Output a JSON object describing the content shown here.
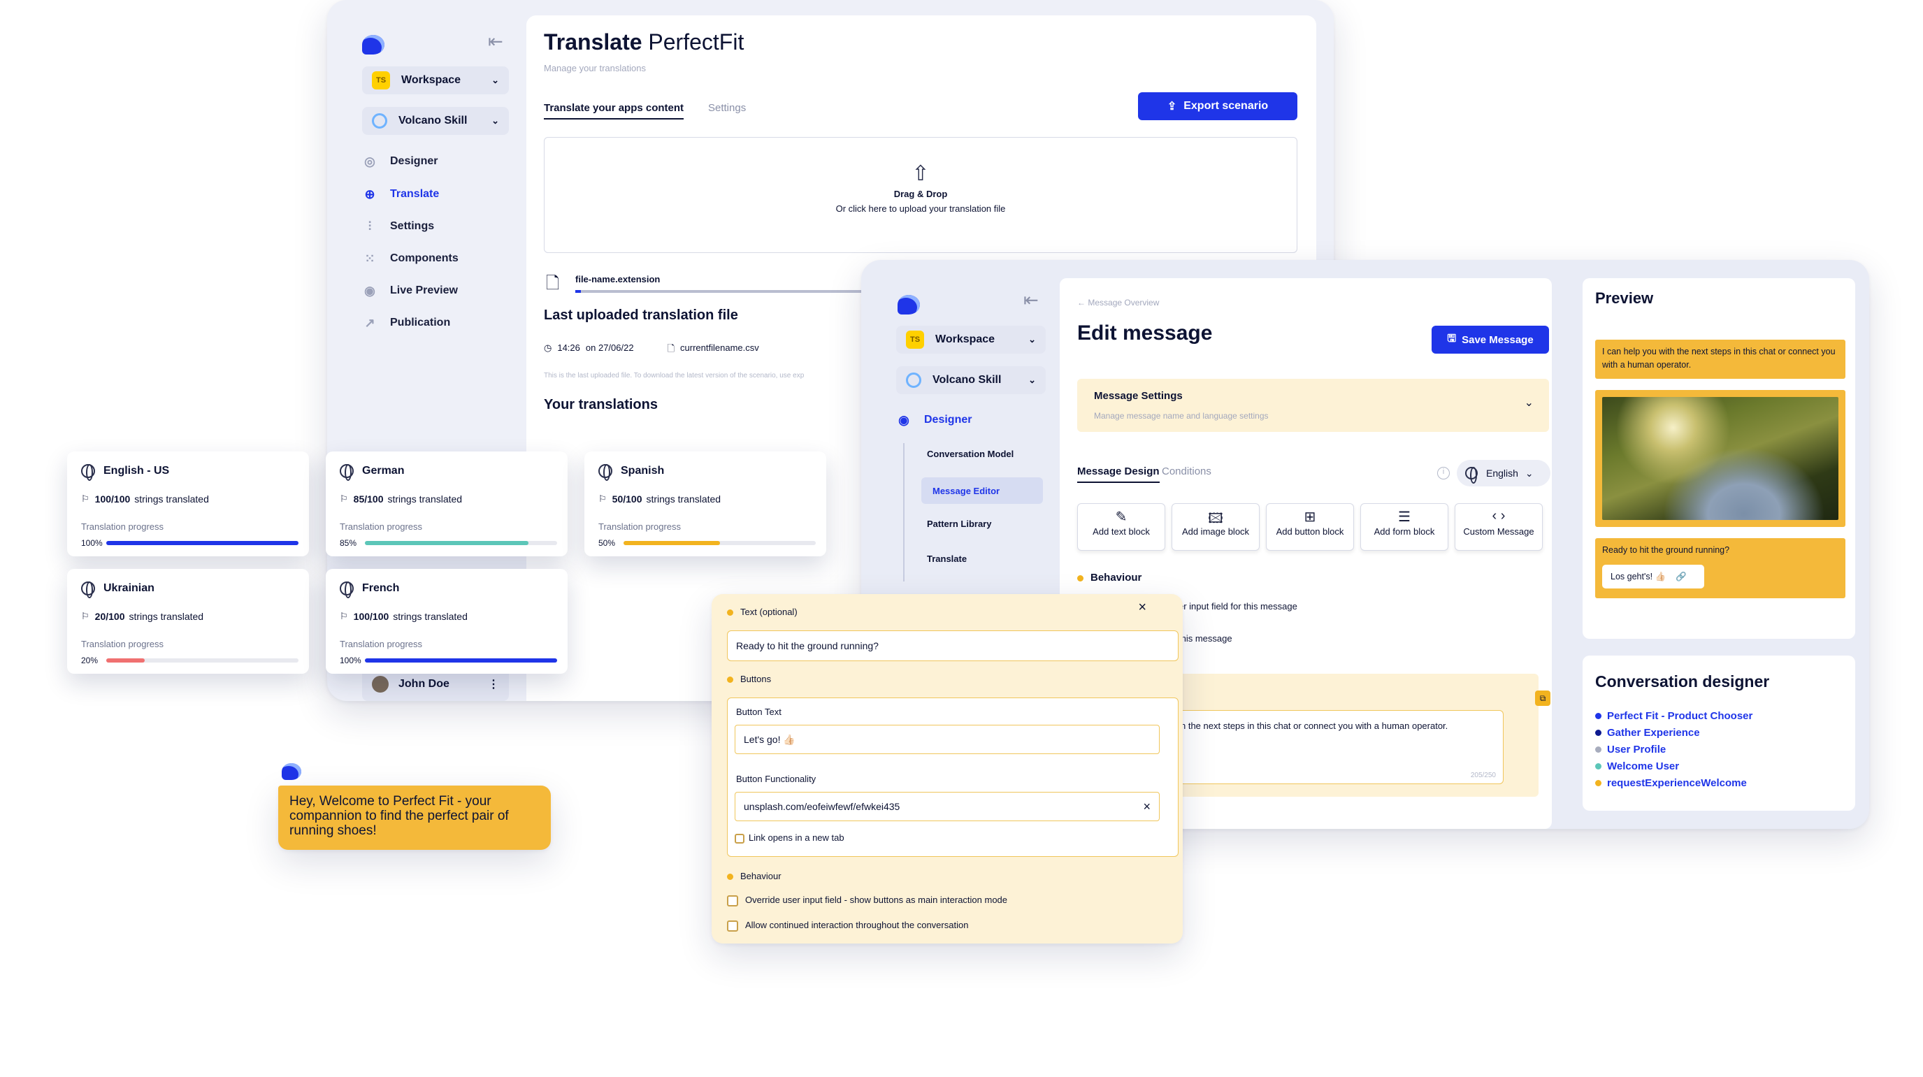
{
  "translate": {
    "logo": "chat-logo",
    "workspace": "Workspace",
    "workspace_badge": "TS",
    "project": "Volcano Skill",
    "nav": [
      "Designer",
      "Translate",
      "Settings",
      "Components",
      "Live Preview",
      "Publication"
    ],
    "title_bold": "Translate",
    "title_rest": " PerfectFit",
    "subtitle": "Manage your translations",
    "tabs": [
      "Translate your apps content",
      "Settings"
    ],
    "export": "Export scenario",
    "drop_title": "Drag & Drop",
    "drop_sub": "Or click here to upload your translation file",
    "file_name": "file-name.extension",
    "last_uploaded": "Last uploaded translation file",
    "time": "14:26",
    "date": "on 27/06/22",
    "current_file": "currentfilename.csv",
    "note": "This is the last uploaded file. To download the latest version of the scenario, use exp",
    "your_translations": "Your translations",
    "user": "John Doe"
  },
  "languages": [
    {
      "name": "English - US",
      "count": "100/100",
      "label": "strings translated",
      "progress_label": "Translation progress",
      "pct": "100%",
      "fraction": 1.0,
      "color": "#1f35e8"
    },
    {
      "name": "German",
      "count": "85/100",
      "label": "strings translated",
      "progress_label": "Translation progress",
      "pct": "85%",
      "fraction": 0.85,
      "color": "#5cc6b8"
    },
    {
      "name": "Spanish",
      "count": "50/100",
      "label": "strings translated",
      "progress_label": "Translation progress",
      "pct": "50%",
      "fraction": 0.5,
      "color": "#f2b31f"
    },
    {
      "name": "Ukrainian",
      "count": "20/100",
      "label": "strings translated",
      "progress_label": "Translation progress",
      "pct": "20%",
      "fraction": 0.2,
      "color": "#f07070"
    },
    {
      "name": "French",
      "count": "100/100",
      "label": "strings translated",
      "progress_label": "Translation progress",
      "pct": "100%",
      "fraction": 1.0,
      "color": "#1f35e8"
    }
  ],
  "editor": {
    "workspace": "Workspace",
    "workspace_badge": "TS",
    "project": "Volcano Skill",
    "nav_designer": "Designer",
    "sub_nav": [
      "Conversation Model",
      "Message Editor",
      "Pattern Library",
      "Translate"
    ],
    "breadcrumb": "Message Overview",
    "title": "Edit message",
    "save": "Save Message",
    "settings_title": "Message Settings",
    "settings_sub": "Manage message name and language settings",
    "tabs": [
      "Message Design",
      "Conditions"
    ],
    "language": "English",
    "tiles": [
      "Add text block",
      "Add image block",
      "Add button block",
      "Add form block",
      "Custom Message"
    ],
    "behaviour": "Behaviour",
    "behaviour_line1": "er input field for this message",
    "behaviour_line2": "this message",
    "msg_text": "n the next steps in this chat or connect you with a human operator.",
    "counter": "205/250"
  },
  "preview": {
    "title": "Preview",
    "bubble1": "I can help you with the next steps in this chat or connect you with a human operator.",
    "bubble2": "Ready to hit the ground running?",
    "button": "Los geht's! 👍🏻"
  },
  "conversation": {
    "title": "Conversation designer",
    "items": [
      {
        "label": "Perfect Fit - Product Chooser",
        "color": "#1f35e8"
      },
      {
        "label": "Gather Experience",
        "color": "#0d1a8f"
      },
      {
        "label": "User Profile",
        "color": "#a7acbd"
      },
      {
        "label": "Welcome User",
        "color": "#5cc6b8"
      },
      {
        "label": "requestExperienceWelcome",
        "color": "#f2b31f"
      }
    ]
  },
  "form": {
    "text_label": "Text (optional)",
    "text_value": "Ready to hit the ground running?",
    "buttons_label": "Buttons",
    "button_text_label": "Button Text",
    "button_text_value": "Let's go! 👍🏻",
    "button_func_label": "Button Functionality",
    "button_func_value": "unsplash.com/eofeiwfewf/efwkei435",
    "new_tab": "Link opens in a new tab",
    "behaviour_label": "Behaviour",
    "opt1": "Override user input field - show buttons as main interaction mode",
    "opt2": "Allow continued interaction throughout the conversation"
  },
  "chat": {
    "message": "Hey, Welcome to Perfect Fit - your compannion to find the perfect pair of running shoes!"
  }
}
